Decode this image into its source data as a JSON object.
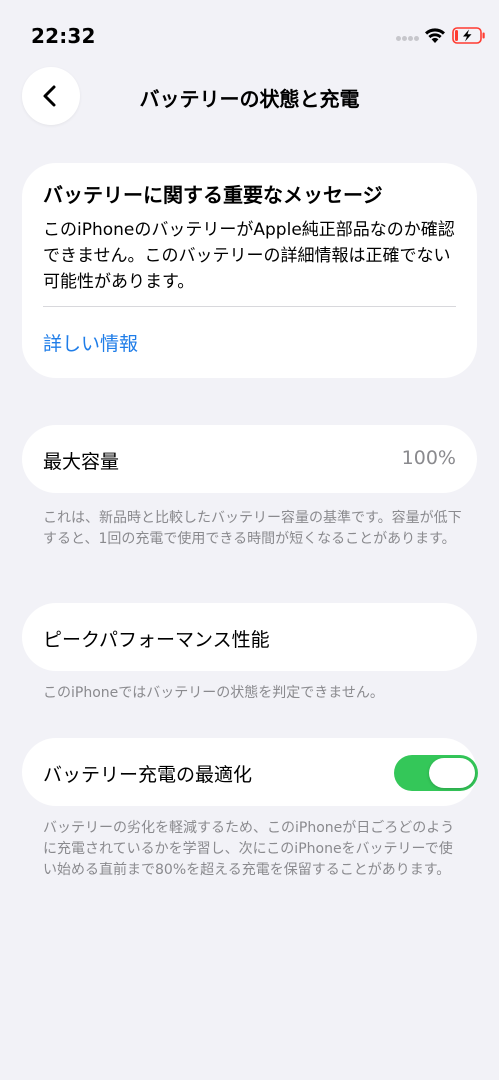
{
  "status_bar": {
    "time": "22:32",
    "icons": [
      "signal-dots-icon",
      "wifi-icon",
      "battery-charging-icon"
    ]
  },
  "nav": {
    "back_icon": "chevron-left-icon",
    "title": "バッテリーの状態と充電"
  },
  "message_card": {
    "title": "バッテリーに関する重要なメッセージ",
    "body": "このiPhoneのバッテリーがApple純正部品なのか確認できません。このバッテリーの詳細情報は正確でない可能性があります。",
    "link": "詳しい情報"
  },
  "max_capacity": {
    "label": "最大容量",
    "value": "100%",
    "footnote": "これは、新品時と比較したバッテリー容量の基準です。容量が低下すると、1回の充電で使用できる時間が短くなることがあります。"
  },
  "peak_performance": {
    "label": "ピークパフォーマンス性能",
    "footnote": "このiPhoneではバッテリーの状態を判定できません。"
  },
  "optimized_charging": {
    "label": "バッテリー充電の最適化",
    "enabled": true,
    "footnote": "バッテリーの劣化を軽減するため、このiPhoneが日ごろどのように充電されているかを学習し、次にこのiPhoneをバッテリーで使い始める直前まで80%を超える充電を保留することがあります。"
  },
  "colors": {
    "background": "#f2f2f7",
    "card": "#ffffff",
    "link": "#1f7de8",
    "toggle_on": "#34c759",
    "secondary_text": "#8a8a8e",
    "battery_low": "#ff3b30"
  }
}
